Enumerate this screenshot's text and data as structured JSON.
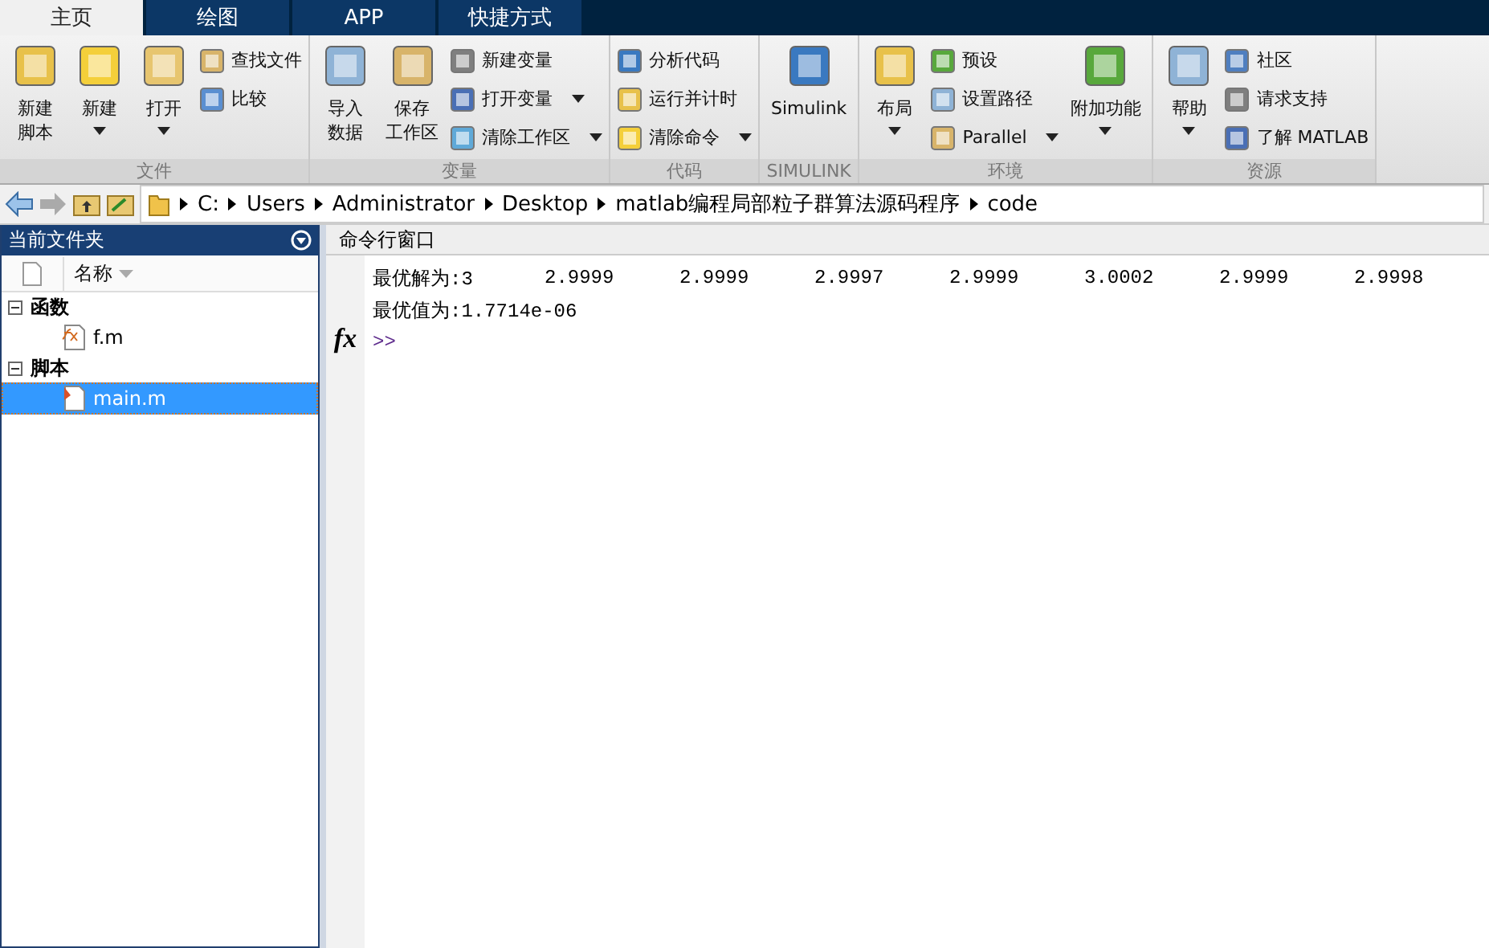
{
  "tabs": [
    {
      "label": "主页",
      "selected": true
    },
    {
      "label": "绘图",
      "selected": false
    },
    {
      "label": "APP",
      "selected": false
    },
    {
      "label": "快捷方式",
      "selected": false
    }
  ],
  "ribbon": [
    {
      "label": "文件",
      "columns": [
        {
          "kind": "large",
          "lines": [
            "新建",
            "脚本"
          ],
          "dropdown": false
        },
        {
          "kind": "large",
          "lines": [
            "新建"
          ],
          "dropdown": true
        },
        {
          "kind": "large",
          "lines": [
            "打开"
          ],
          "dropdown": true
        },
        {
          "kind": "stack",
          "items": [
            {
              "label": "查找文件",
              "dropdown": false
            },
            {
              "label": "比较",
              "dropdown": false
            }
          ]
        }
      ]
    },
    {
      "label": "变量",
      "columns": [
        {
          "kind": "large",
          "lines": [
            "导入",
            "数据"
          ],
          "dropdown": false
        },
        {
          "kind": "large",
          "lines": [
            "保存",
            "工作区"
          ],
          "dropdown": false
        },
        {
          "kind": "stack",
          "items": [
            {
              "label": "新建变量",
              "dropdown": false
            },
            {
              "label": "打开变量",
              "dropdown": true
            },
            {
              "label": "清除工作区",
              "dropdown": true
            }
          ]
        }
      ]
    },
    {
      "label": "代码",
      "columns": [
        {
          "kind": "stack",
          "items": [
            {
              "label": "分析代码",
              "dropdown": false
            },
            {
              "label": "运行并计时",
              "dropdown": false
            },
            {
              "label": "清除命令",
              "dropdown": true
            }
          ]
        }
      ]
    },
    {
      "label": "SIMULINK",
      "columns": [
        {
          "kind": "large",
          "lines": [
            "Simulink"
          ],
          "dropdown": false
        }
      ]
    },
    {
      "label": "环境",
      "columns": [
        {
          "kind": "large",
          "lines": [
            "布局"
          ],
          "dropdown": true
        },
        {
          "kind": "stack",
          "items": [
            {
              "label": "预设",
              "dropdown": false
            },
            {
              "label": "设置路径",
              "dropdown": false
            },
            {
              "label": "Parallel",
              "dropdown": true
            }
          ]
        },
        {
          "kind": "large",
          "lines": [
            "附加功能"
          ],
          "dropdown": true
        }
      ]
    },
    {
      "label": "资源",
      "columns": [
        {
          "kind": "large",
          "lines": [
            "帮助"
          ],
          "dropdown": true
        },
        {
          "kind": "stack",
          "items": [
            {
              "label": "社区",
              "dropdown": false
            },
            {
              "label": "请求支持",
              "dropdown": false
            },
            {
              "label": "了解 MATLAB",
              "dropdown": false
            }
          ]
        }
      ]
    }
  ],
  "path": [
    "C:",
    "Users",
    "Administrator",
    "Desktop",
    "matlab编程局部粒子群算法源码程序",
    "code"
  ],
  "folder_pane": {
    "title": "当前文件夹",
    "column": "名称",
    "groups": [
      {
        "label": "函数",
        "expanded": true,
        "children": [
          {
            "name": "f.m",
            "kind": "function",
            "selected": false
          }
        ]
      },
      {
        "label": "脚本",
        "expanded": true,
        "children": [
          {
            "name": "main.m",
            "kind": "script",
            "selected": true
          }
        ]
      }
    ]
  },
  "command_window": {
    "title": "命令行窗口",
    "lines": [
      [
        "最优解为:3",
        "2.9999",
        "2.9999",
        "2.9997",
        "2.9999",
        "3.0002",
        "2.9999",
        "2.9998"
      ],
      [
        "最优值为:1.7714e-06"
      ]
    ],
    "prompt": ">>",
    "function_button": "fx"
  }
}
